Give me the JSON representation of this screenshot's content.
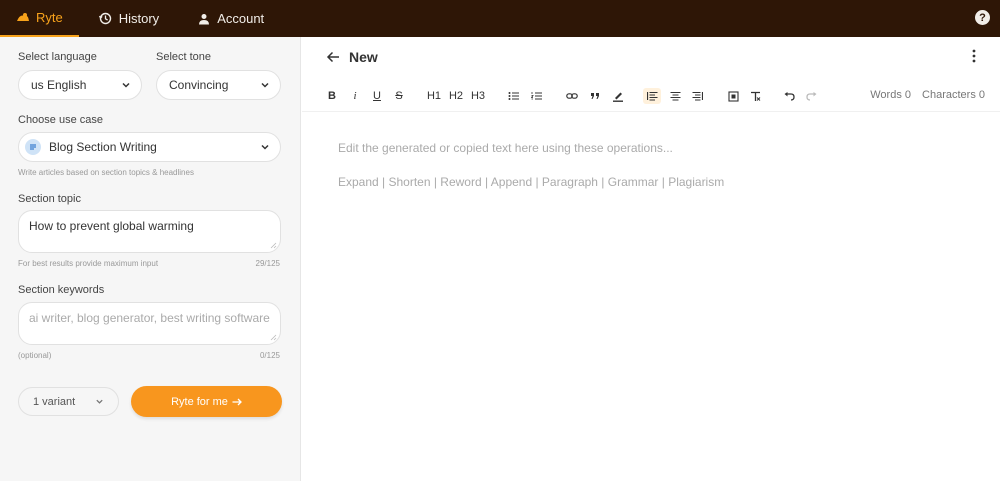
{
  "nav": {
    "brand": "Ryte",
    "history": "History",
    "account": "Account",
    "help_icon": "question-circle-icon",
    "accent_color": "#f7a21b",
    "bar_color": "#2e1606"
  },
  "form": {
    "language": {
      "label": "Select language",
      "value": "us English"
    },
    "tone": {
      "label": "Select tone",
      "value": "Convincing"
    },
    "use_case": {
      "label": "Choose use case",
      "value": "Blog Section Writing",
      "hint": "Write articles based on section topics & headlines"
    },
    "topic": {
      "label": "Section topic",
      "value": "How to prevent global warming",
      "hint": "For best results provide maximum input",
      "count": "29/125"
    },
    "keywords": {
      "label": "Section keywords",
      "placeholder": "ai writer, blog generator, best writing software",
      "hint": "(optional)",
      "count": "0/125"
    },
    "variants": {
      "value": "1 variant"
    },
    "submit": {
      "label": "Ryte for me",
      "color": "#f8961e"
    }
  },
  "editor": {
    "title": "New",
    "toolbar": {
      "bold": "B",
      "italic": "i",
      "underline": "U",
      "strike": "S",
      "h1": "H1",
      "h2": "H2",
      "h3": "H3",
      "words": "Words 0",
      "characters": "Characters 0"
    },
    "placeholder_line1": "Edit the generated or copied text here using these operations...",
    "placeholder_line2": "Expand | Shorten | Reword | Append | Paragraph | Grammar | Plagiarism"
  }
}
